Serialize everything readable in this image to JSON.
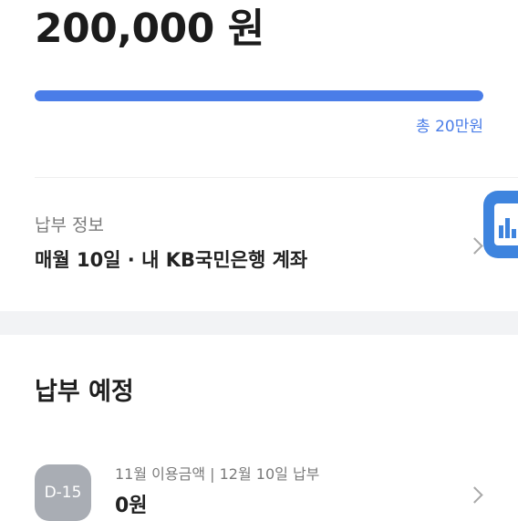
{
  "amount": "200,000 원",
  "progress": {
    "fraction": 1.0,
    "total_label": "총 20만원"
  },
  "pay_info": {
    "label": "납부 정보",
    "value": "매월 10일 · 내 KB국민은행 계좌"
  },
  "schedule": {
    "title": "납부 예정",
    "items": [
      {
        "dday": "D-15",
        "description": "11월 이용금액 | 12월 10일 납부",
        "amount": "0원"
      }
    ]
  },
  "colors": {
    "accent": "#4a7de8",
    "badge": "#a9adb4",
    "icon_bg": "#3e84de"
  },
  "icons": [
    "chevron-right-icon",
    "bank-app-icon"
  ]
}
